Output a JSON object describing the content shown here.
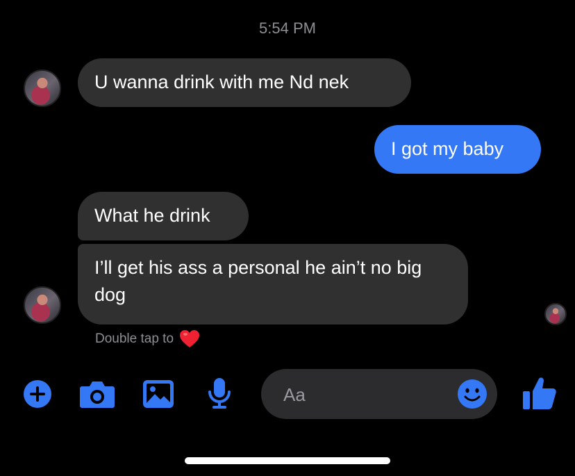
{
  "timestamp": "5:54 PM",
  "messages": [
    {
      "sender": "them",
      "text": "U wanna drink with me Nd nek"
    },
    {
      "sender": "me",
      "text": "I got my baby"
    },
    {
      "sender": "them",
      "text": "What he drink"
    },
    {
      "sender": "them",
      "text": "I’ll get his ass a personal he ain’t no big dog"
    }
  ],
  "reaction_hint": {
    "text": "Double tap to",
    "emoji": "heart-icon"
  },
  "composer": {
    "placeholder": "Aa"
  },
  "toolbar": {
    "icons": [
      "plus-icon",
      "camera-icon",
      "image-icon",
      "microphone-icon",
      "emoji-icon",
      "thumbs-up-icon"
    ]
  },
  "colors": {
    "accent": "#3478f6",
    "incoming_bubble": "#303030",
    "background": "#000000",
    "muted_text": "#8e8e93"
  }
}
